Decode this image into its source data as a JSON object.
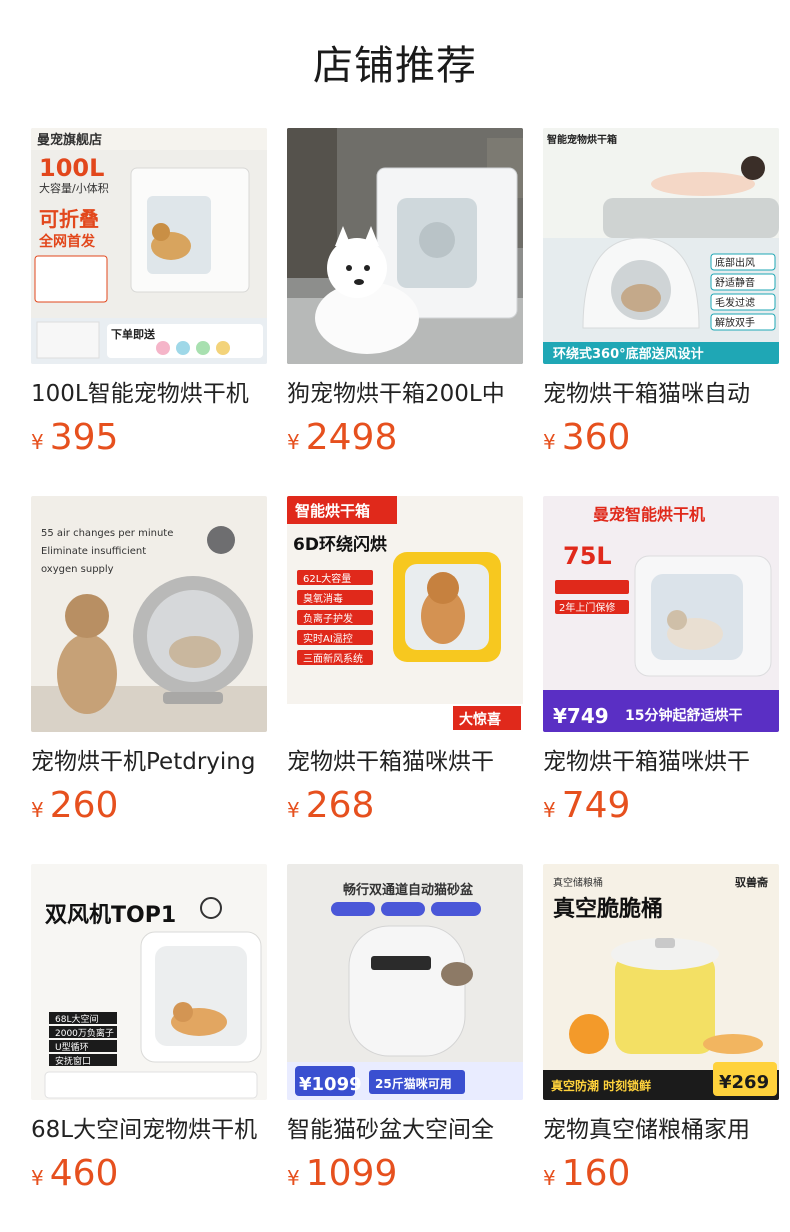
{
  "header": {
    "title": "店铺推荐"
  },
  "colors": {
    "price": "#e6501e",
    "text": "#222222"
  },
  "currency_symbol": "¥",
  "products": [
    {
      "name": "100L智能宠物烘干机",
      "price": "395",
      "image_text": [
        "曼宠旗舰店",
        "100L",
        "大容量/小体积",
        "可折叠",
        "全网首发",
        "下单即送"
      ]
    },
    {
      "name": "狗宠物烘干箱200L中",
      "price": "2498",
      "image_text": []
    },
    {
      "name": "宠物烘干箱猫咪自动",
      "price": "360",
      "image_text": [
        "智能宠物烘干箱",
        "底部出风",
        "舒适静音",
        "毛发过滤",
        "解放双手",
        "环绕式360°底部送风设计"
      ]
    },
    {
      "name": "宠物烘干机Petdrying",
      "price": "260",
      "image_text": [
        "55 air changes per minute",
        "Eliminate insufficient",
        "oxygen supply"
      ]
    },
    {
      "name": "宠物烘干箱猫咪烘干",
      "price": "268",
      "image_text": [
        "智能烘干箱",
        "6D环绕闪烘",
        "62L大容量",
        "臭氧消毒",
        "负离子护发",
        "实时AI温控",
        "三面新风系统",
        "大惊喜"
      ]
    },
    {
      "name": "宠物烘干箱猫咪烘干",
      "price": "749",
      "image_text": [
        "曼宠智能烘干机",
        "75L",
        "2年上门保修",
        "¥749",
        "15分钟起舒适烘干"
      ]
    },
    {
      "name": "68L大空间宠物烘干机",
      "price": "460",
      "image_text": [
        "双风机TOP1",
        "68L大空间",
        "2000万负离子",
        "U型循环",
        "安抚窗口"
      ]
    },
    {
      "name": "智能猫砂盆大空间全",
      "price": "1099",
      "image_text": [
        "畅行双通道自动猫砂盆",
        "¥1099",
        "25斤猫咪可用"
      ]
    },
    {
      "name": "宠物真空储粮桶家用",
      "price": "160",
      "image_text": [
        "真空储粮桶",
        "驭兽斋",
        "真空脆脆桶",
        "真空防潮 时刻锁鲜",
        "¥269"
      ]
    }
  ]
}
